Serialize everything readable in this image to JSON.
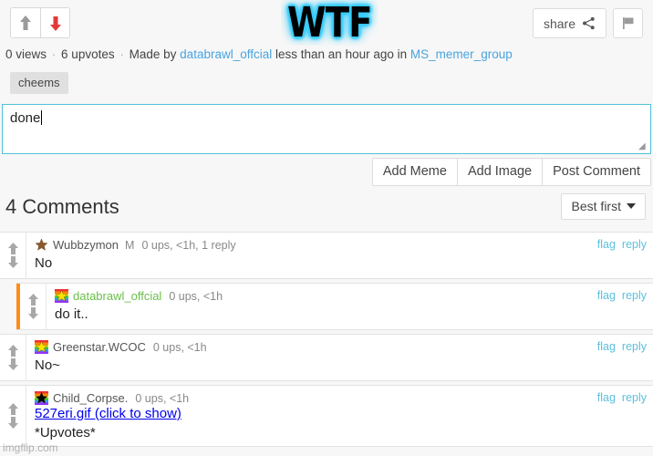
{
  "post": {
    "vote_up_icon": "arrow-up-icon",
    "vote_down_icon": "arrow-down-icon",
    "meme_text": "WTF",
    "share_label": "share",
    "share_icon": "share-icon",
    "flag_icon": "flag-icon",
    "views": "0 views",
    "upvotes": "6 upvotes",
    "made_by_prefix": "Made by",
    "author": "databrawl_offcial",
    "time": "less than an hour ago",
    "in_prefix": "in",
    "stream": "MS_memer_group",
    "tag": "cheems"
  },
  "composer": {
    "value": "done",
    "add_meme_label": "Add Meme",
    "add_image_label": "Add Image",
    "post_comment_label": "Post Comment"
  },
  "comments_header": {
    "title": "4 Comments",
    "sort_label": "Best first",
    "sort_icon": "chevron-down-icon"
  },
  "comments": [
    {
      "avatar": "bronze-star-avatar",
      "avatar_style": "bronze",
      "username": "Wubbzymon",
      "username_style": "plain",
      "badge": "M",
      "stats": "0 ups, <1h, 1 reply",
      "text": "No",
      "flag_label": "flag",
      "reply_label": "reply",
      "is_reply": false
    },
    {
      "avatar": "rainbow-yellow-star-avatar",
      "avatar_style": "rainbow-yellow",
      "username": "databrawl_offcial",
      "username_style": "green",
      "badge": "",
      "stats": "0 ups, <1h",
      "text": "do it..",
      "flag_label": "flag",
      "reply_label": "reply",
      "is_reply": true
    },
    {
      "avatar": "rainbow-yellow-star-avatar",
      "avatar_style": "rainbow-yellow",
      "username": "Greenstar.WCOC",
      "username_style": "plain",
      "badge": "",
      "stats": "0 ups, <1h",
      "text": "No~",
      "flag_label": "flag",
      "reply_label": "reply",
      "is_reply": false
    },
    {
      "avatar": "rainbow-black-star-avatar",
      "avatar_style": "rainbow-black",
      "username": "Child_Corpse.",
      "username_style": "plain",
      "badge": "",
      "stats": "0 ups, <1h",
      "gif_link": "527eri.gif (click to show)",
      "text": "*Upvotes*",
      "flag_label": "flag",
      "reply_label": "reply",
      "is_reply": false
    }
  ],
  "watermark": "imgflip.com",
  "colors": {
    "accent_link": "#4aa3df",
    "action_link": "#5bc0de",
    "focus_border": "#4fc3d9",
    "downvote_active": "#e23a3a",
    "reply_bar": "#ff8c1a",
    "green_user": "#6abf4b",
    "meme_glow": "#35c8f5"
  }
}
